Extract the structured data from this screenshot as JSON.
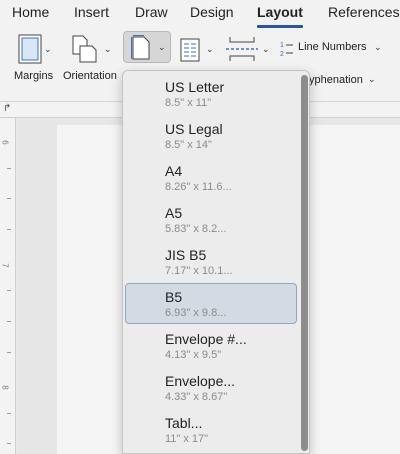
{
  "tabs": [
    {
      "label": "Home"
    },
    {
      "label": "Insert"
    },
    {
      "label": "Draw"
    },
    {
      "label": "Design"
    },
    {
      "label": "Layout"
    },
    {
      "label": "References"
    }
  ],
  "active_tab": "Layout",
  "ribbon": {
    "margins_label": "Margins",
    "orientation_label": "Orientation",
    "line_numbers_label": "Line Numbers",
    "hyphenation_label": "yphenation"
  },
  "ruler": {
    "tick_6": "6",
    "tick_7": "7",
    "tick_8": "8"
  },
  "size_menu": {
    "selected": "B5",
    "items": [
      {
        "name": "US Letter",
        "size": "8.5\" x 11\""
      },
      {
        "name": "US Legal",
        "size": "8.5\" x 14\""
      },
      {
        "name": "A4",
        "size": "8.26\" x 11.6..."
      },
      {
        "name": "A5",
        "size": "5.83\" x 8.2..."
      },
      {
        "name": "JIS B5",
        "size": "7.17\" x 10.1..."
      },
      {
        "name": "B5",
        "size": "6.93\" x 9.8..."
      },
      {
        "name": "Envelope #...",
        "size": "4.13\" x 9.5\""
      },
      {
        "name": "Envelope...",
        "size": "4.33\" x 8.67\""
      },
      {
        "name": "Tabl...",
        "size": "11\" x 17\""
      }
    ]
  },
  "colors": {
    "accent": "#2b579a",
    "selected_bg": "#d3dae4",
    "selected_border": "#8ea7c7"
  }
}
